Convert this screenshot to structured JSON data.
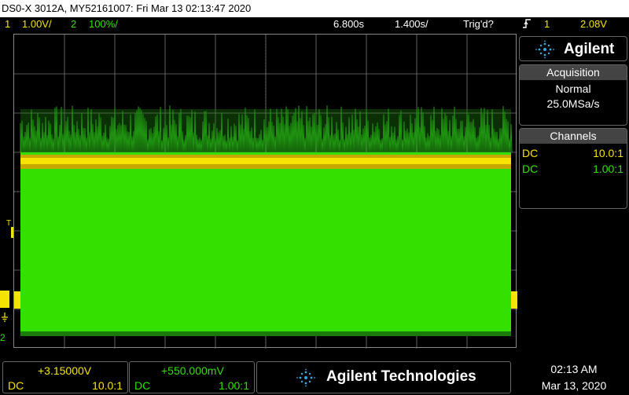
{
  "window": {
    "title": "DS0-X 3012A, MY52161007: Fri Mar 13 02:13:47 2020"
  },
  "status": {
    "ch1_num": "1",
    "ch1_scale": "1.00V/",
    "ch2_num": "2",
    "ch2_scale": "100%/",
    "time_pos": "6.800s",
    "time_scale": "1.400s/",
    "trigger_state": "Trig'd?",
    "trigger_edge_icon": "rising-edge-icon",
    "trigger_source": "1",
    "trigger_level": "2.08V"
  },
  "brand_logo": {
    "name": "Agilent"
  },
  "acquisition": {
    "header": "Acquisition",
    "mode": "Normal",
    "rate": "25.0MSa/s"
  },
  "channels": {
    "header": "Channels",
    "rows": [
      {
        "coupling": "DC",
        "probe": "10.0:1",
        "color": "#f5e400"
      },
      {
        "coupling": "DC",
        "probe": "1.00:1",
        "color": "#33e000"
      }
    ]
  },
  "markers": {
    "trigger_level": "T",
    "ch2_ground": "2"
  },
  "bottom": {
    "ch1": {
      "offset": "+3.15000V",
      "coupling": "DC",
      "probe": "10.0:1"
    },
    "ch2": {
      "offset": "+550.000mV",
      "coupling": "DC",
      "probe": "1.00:1"
    },
    "brand": "Agilent Technologies",
    "time": "02:13 AM",
    "date": "Mar 13, 2020"
  },
  "colors": {
    "ch1": "#f5e400",
    "ch2": "#33e000",
    "grid": "#777777"
  }
}
